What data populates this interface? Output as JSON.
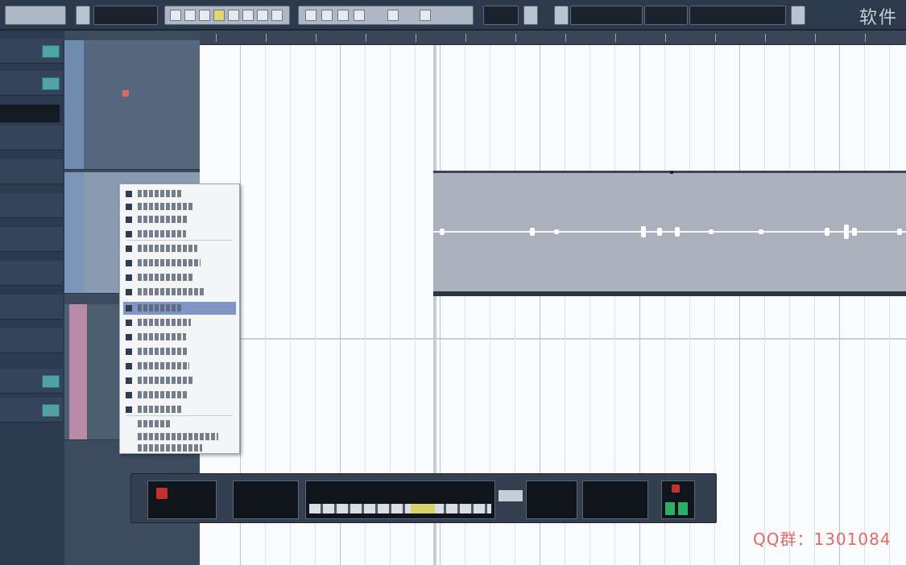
{
  "app": {
    "watermark_text": "软件",
    "bottom_watermark": "QQ群：1301084"
  },
  "colors": {
    "toolbar_bg": "#2c3a4c",
    "accent_selection": "#7f96c5",
    "event_bg": "#aab1bd",
    "transport_record": "#c2312c",
    "meter_green": "#2fae6a"
  },
  "inspector": {
    "rows": [
      "",
      "",
      "",
      "",
      "",
      "",
      "",
      "",
      "",
      ""
    ]
  },
  "context_menu": {
    "items_count": 19,
    "selected_index": 8
  }
}
